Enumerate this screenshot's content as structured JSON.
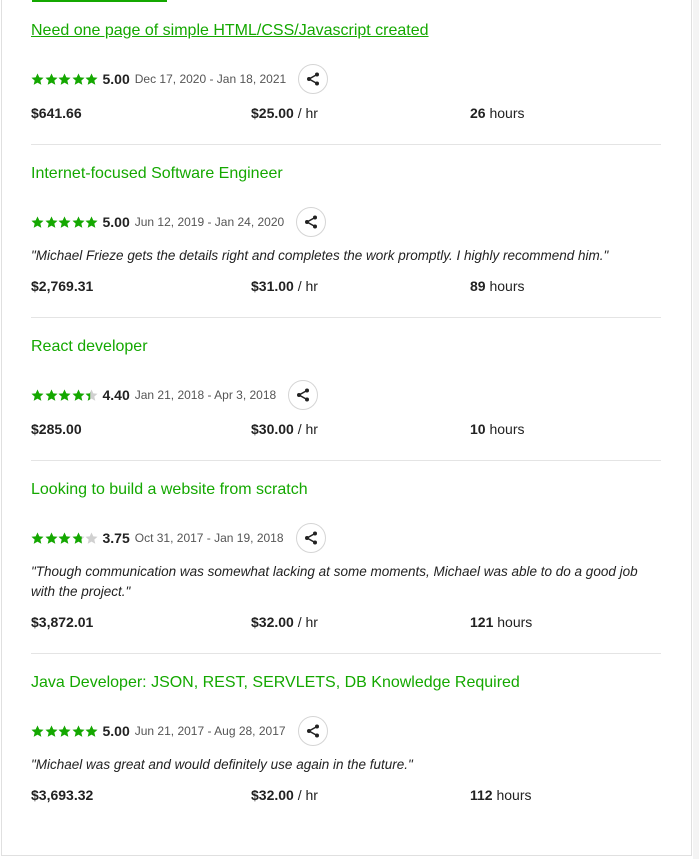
{
  "colors": {
    "accent": "#14a800",
    "star": "#14a800",
    "star_empty": "#d0d0d0"
  },
  "jobs": [
    {
      "title": "Need one page of simple HTML/CSS/Javascript created",
      "rating": 5.0,
      "score": "5.00",
      "dates": "Dec 17, 2020 - Jan 18, 2021",
      "feedback": "",
      "earned": "$641.66",
      "rate": "$25.00",
      "rate_unit": " / hr",
      "hours": "26",
      "hours_unit": " hours"
    },
    {
      "title": "Internet-focused Software Engineer",
      "rating": 5.0,
      "score": "5.00",
      "dates": "Jun 12, 2019 - Jan 24, 2020",
      "feedback": "\"Michael Frieze gets the details right and completes the work promptly. I highly recommend him.\"",
      "earned": "$2,769.31",
      "rate": "$31.00",
      "rate_unit": " / hr",
      "hours": "89",
      "hours_unit": " hours"
    },
    {
      "title": "React developer",
      "rating": 4.4,
      "score": "4.40",
      "dates": "Jan 21, 2018 - Apr 3, 2018",
      "feedback": "",
      "earned": "$285.00",
      "rate": "$30.00",
      "rate_unit": " / hr",
      "hours": "10",
      "hours_unit": " hours"
    },
    {
      "title": "Looking to build a website from scratch",
      "rating": 3.75,
      "score": "3.75",
      "dates": "Oct 31, 2017 - Jan 19, 2018",
      "feedback": "\"Though communication was somewhat lacking at some moments, Michael was able to do a good job with the project.\"",
      "earned": "$3,872.01",
      "rate": "$32.00",
      "rate_unit": " / hr",
      "hours": "121",
      "hours_unit": " hours"
    },
    {
      "title": "Java Developer: JSON, REST, SERVLETS, DB Knowledge Required",
      "rating": 5.0,
      "score": "5.00",
      "dates": "Jun 21, 2017 - Aug 28, 2017",
      "feedback": "\"Michael was great and would definitely use again in the future.\"",
      "earned": "$3,693.32",
      "rate": "$32.00",
      "rate_unit": " / hr",
      "hours": "112",
      "hours_unit": " hours"
    }
  ]
}
